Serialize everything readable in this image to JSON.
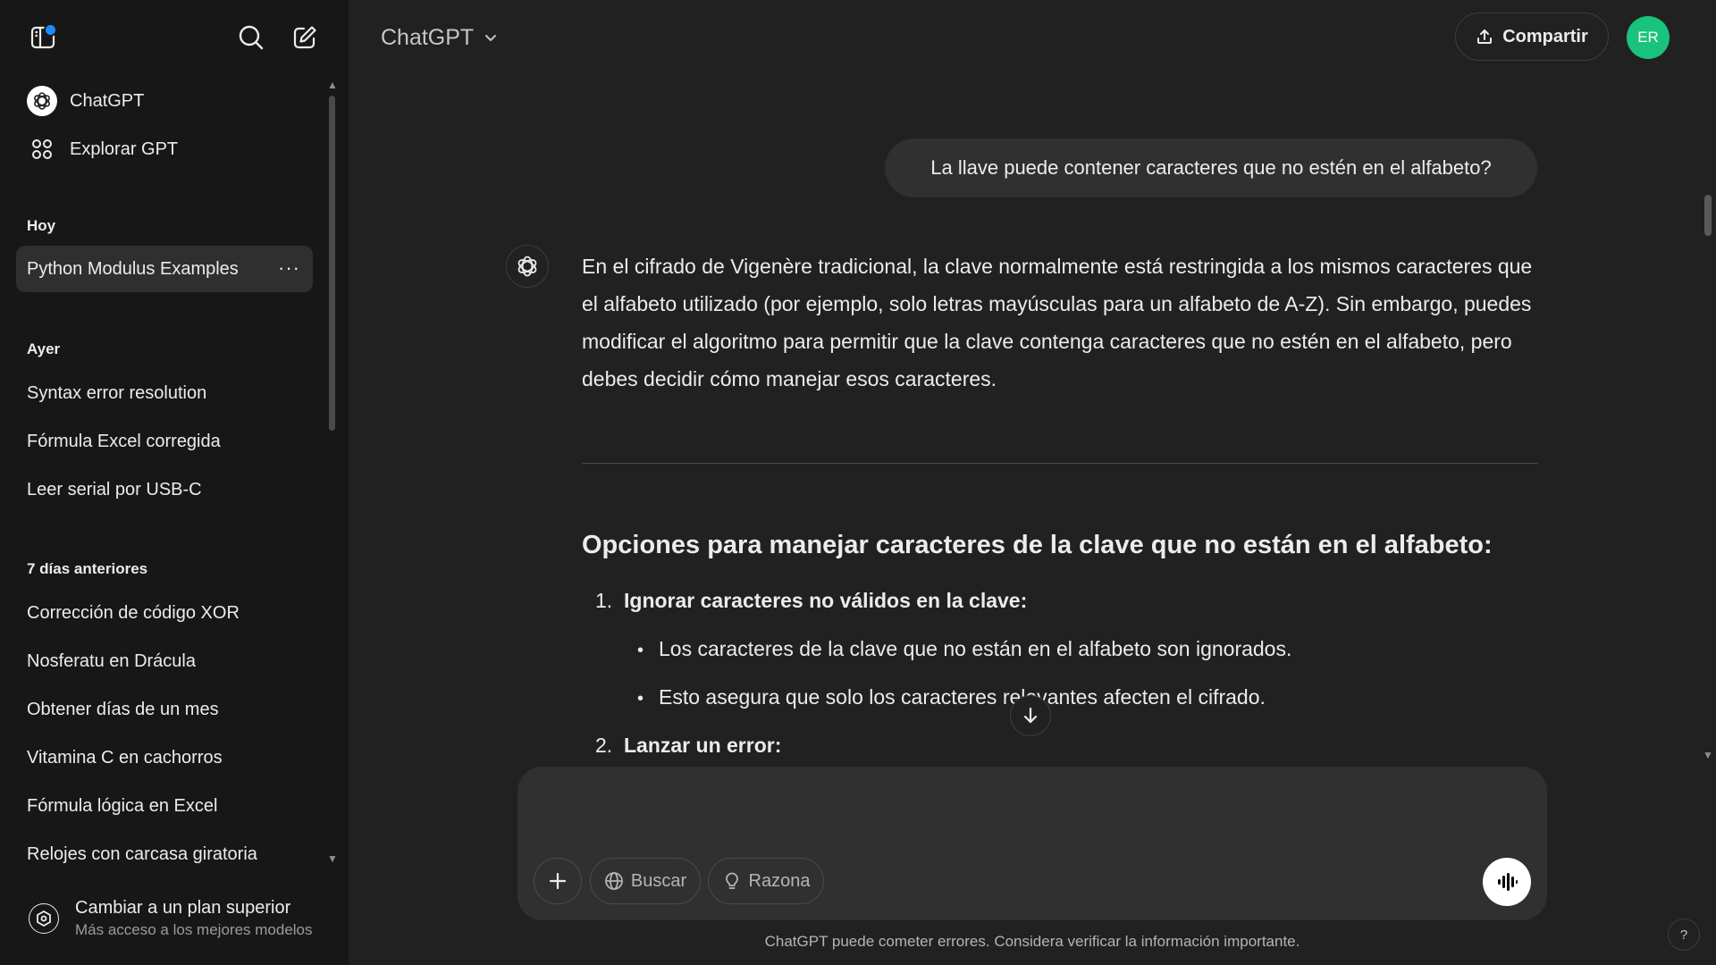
{
  "sidebar": {
    "toggle_icon": "sidebar-toggle-icon",
    "search_icon": "search-icon",
    "new_chat_icon": "new-chat-icon",
    "nav": [
      {
        "label": "ChatGPT",
        "icon": "chatgpt-logo-icon"
      },
      {
        "label": "Explorar GPT",
        "icon": "grid-icon"
      }
    ],
    "sections": [
      {
        "title": "Hoy",
        "items": [
          "Python Modulus Examples"
        ]
      },
      {
        "title": "Ayer",
        "items": [
          "Syntax error resolution",
          "Fórmula Excel corregida",
          "Leer serial por USB-C"
        ]
      },
      {
        "title": "7 días anteriores",
        "items": [
          "Corrección de código XOR",
          "Nosferatu en Drácula",
          "Obtener días de un mes",
          "Vitamina C en cachorros",
          "Fórmula lógica en Excel",
          "Relojes con carcasa giratoria"
        ]
      }
    ],
    "active_item_more": "···",
    "upgrade": {
      "title": "Cambiar a un plan superior",
      "subtitle": "Más acceso a los mejores modelos"
    }
  },
  "header": {
    "model": "ChatGPT",
    "share_label": "Compartir",
    "avatar_initials": "ER"
  },
  "chat": {
    "user_message": "La llave puede contener caracteres que no estén en el alfabeto?",
    "assistant": {
      "paragraph": "En el cifrado de Vigenère tradicional, la clave normalmente está restringida a los mismos caracteres que el alfabeto utilizado (por ejemplo, solo letras mayúsculas para un alfabeto de A-Z). Sin embargo, puedes modificar el algoritmo para permitir que la clave contenga caracteres que no estén en el alfabeto, pero debes decidir cómo manejar esos caracteres.",
      "heading": "Opciones para manejar caracteres de la clave que no están en el alfabeto:",
      "list": [
        {
          "num": "1.",
          "title": "Ignorar caracteres no válidos en la clave:",
          "bullets": [
            "Los caracteres de la clave que no están en el alfabeto son ignorados.",
            "Esto asegura que solo los caracteres relevantes afecten el cifrado."
          ]
        },
        {
          "num": "2.",
          "title": "Lanzar un error:",
          "bullets": []
        }
      ]
    }
  },
  "composer": {
    "placeholder": "",
    "search_label": "Buscar",
    "reason_label": "Razona"
  },
  "footer": {
    "disclaimer": "ChatGPT puede cometer errores. Considera verificar la información importante.",
    "help": "?"
  },
  "colors": {
    "background": "#212121",
    "sidebar": "#171717",
    "bubble": "#303030",
    "avatar_green": "#19c37d",
    "notification_dot": "#1a8cff"
  }
}
